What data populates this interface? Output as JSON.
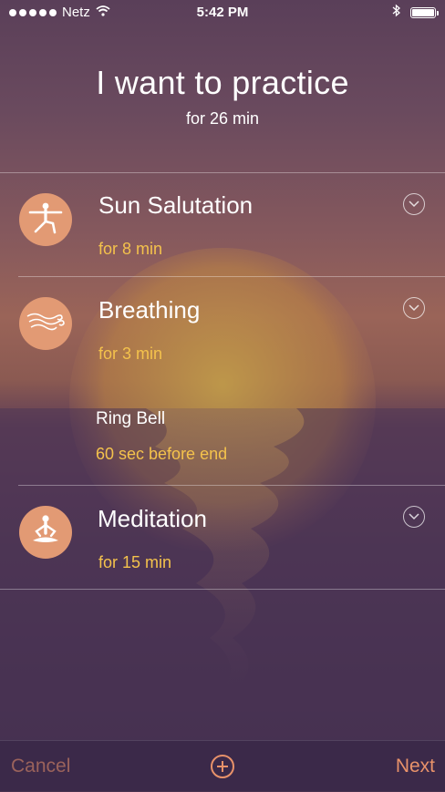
{
  "status_bar": {
    "carrier": "Netz",
    "time": "5:42 PM",
    "icons": [
      "signal-dots",
      "wifi-icon",
      "bluetooth-icon",
      "battery-icon"
    ]
  },
  "header": {
    "title": "I want to practice",
    "duration": "for 26 min"
  },
  "items": [
    {
      "title": "Sun Salutation",
      "duration": "for 8 min",
      "icon": "yoga-pose-icon"
    },
    {
      "title": "Breathing",
      "duration": "for 3 min",
      "icon": "wind-icon"
    },
    {
      "title": "Meditation",
      "duration": "for 15 min",
      "icon": "meditation-icon"
    }
  ],
  "bell": {
    "title": "Ring Bell",
    "timing": "60 sec before end"
  },
  "bottom_bar": {
    "cancel_label": "Cancel",
    "next_label": "Next",
    "add_icon": "plus-circle-icon"
  },
  "colors": {
    "accent": "#e8926a",
    "subtext": "#f4c24c",
    "icon_circle": "#e29a74"
  }
}
